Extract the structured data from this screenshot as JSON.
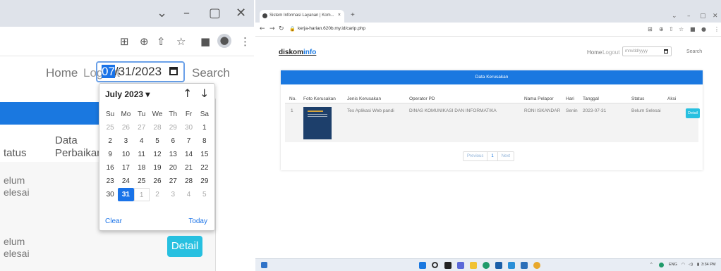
{
  "left_zoom": {
    "window_controls": [
      "⌄",
      "–",
      "▢",
      "✕"
    ],
    "nav": {
      "home": "Home",
      "logout": "Logout",
      "date_selected": "07",
      "date_rest": "/31/2023",
      "search": "Search"
    },
    "datepicker": {
      "month_label": "July 2023 ▾",
      "prev": "↑",
      "next": "↓",
      "weekdays": [
        "Su",
        "Mo",
        "Tu",
        "We",
        "Th",
        "Fr",
        "Sa"
      ],
      "weeks": [
        [
          "25",
          "26",
          "27",
          "28",
          "29",
          "30",
          "1"
        ],
        [
          "2",
          "3",
          "4",
          "5",
          "6",
          "7",
          "8"
        ],
        [
          "9",
          "10",
          "11",
          "12",
          "13",
          "14",
          "15"
        ],
        [
          "16",
          "17",
          "18",
          "19",
          "20",
          "21",
          "22"
        ],
        [
          "23",
          "24",
          "25",
          "26",
          "27",
          "28",
          "29"
        ],
        [
          "30",
          "31",
          "1",
          "2",
          "3",
          "4",
          "5"
        ]
      ],
      "clear": "Clear",
      "today": "Today"
    },
    "columns": {
      "status": "tatus",
      "data_perbaikan": "Data\nPerbaikan"
    },
    "rows": [
      {
        "status": "elum\nelesai"
      },
      {
        "status": "elum\nelesai"
      }
    ],
    "detail_button": "Detail"
  },
  "browser": {
    "tab_title": "Sistem Informasi Layanan | Kom...",
    "tab_close": "×",
    "new_tab": "+",
    "url": "kerja-harian.620b.my.id/carip.php",
    "header": {
      "logo_main": "diskom",
      "logo_accent": "info",
      "home": "Home",
      "logout": "Logout",
      "date_placeholder": "mm/dd/yyyy",
      "search": "Search"
    },
    "panel_title": "Data Kerusakan",
    "columns": [
      "No.",
      "Foto Kerusakan",
      "Jenis Kerusakan",
      "Operator PD",
      "Nama Pelapor",
      "Hari",
      "Tanggal",
      "Status",
      "Aksi"
    ],
    "row": {
      "no": "1",
      "jenis": "Tes Aplikasi Web pandi",
      "operator": "DINAS KOMUNIKASI DAN INFORMATIKA",
      "pelapor": "RONI ISKANDAR",
      "hari": "Senin",
      "tanggal": "2023-07-31",
      "status": "Belum Selesai",
      "aksi": "Detail"
    },
    "pager": {
      "previous": "Previous",
      "page": "1",
      "next": "Next"
    },
    "taskbar": {
      "lang": "ENG",
      "time": "3:34 PM"
    }
  }
}
